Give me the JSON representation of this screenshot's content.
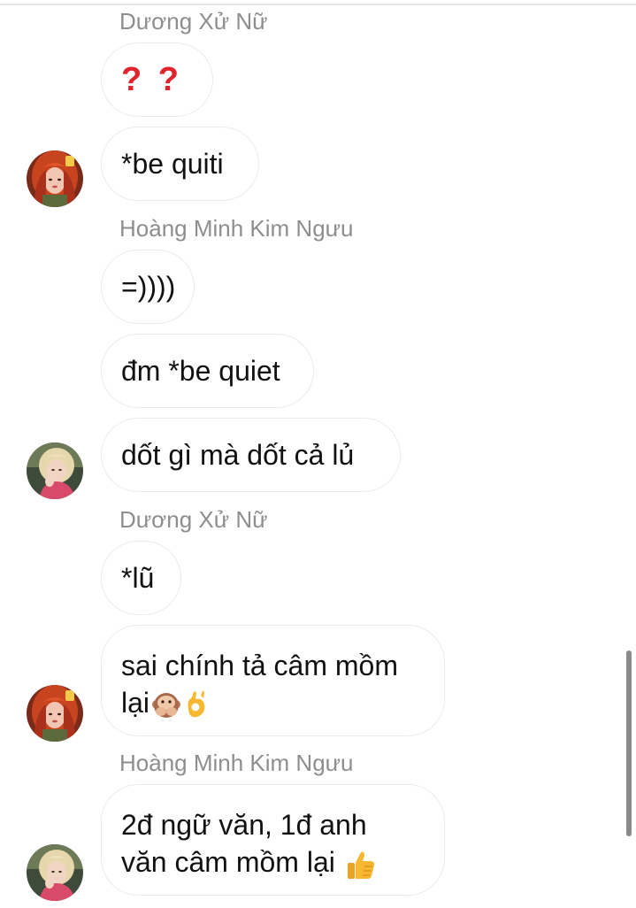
{
  "messages": [
    {
      "sender": "Dương Xử Nữ",
      "text": "? ?"
    },
    {
      "text": "*be quiti"
    },
    {
      "sender": "Hoàng Minh Kim Ngưu",
      "text": "=))))"
    },
    {
      "text": "đm *be quiet"
    },
    {
      "text": "dốt gì mà dốt cả lủ"
    },
    {
      "sender": "Dương Xử Nữ",
      "text": "*lũ"
    },
    {
      "line1": "sai chính tả câm mồm",
      "line2": "lại"
    },
    {
      "sender": "Hoàng Minh Kim Ngưu",
      "line1": "2đ ngữ văn, 1đ anh",
      "line2": "văn câm mồm lại"
    }
  ],
  "icons": {
    "monkey": "speak-no-evil-monkey-icon",
    "ok_hand": "ok-hand-icon",
    "thumbs_up": "thumbs-up-icon"
  },
  "colors": {
    "question_marks": "#e0242c",
    "sender_name": "#8e8e8e",
    "bubble_border": "#ebebeb"
  }
}
